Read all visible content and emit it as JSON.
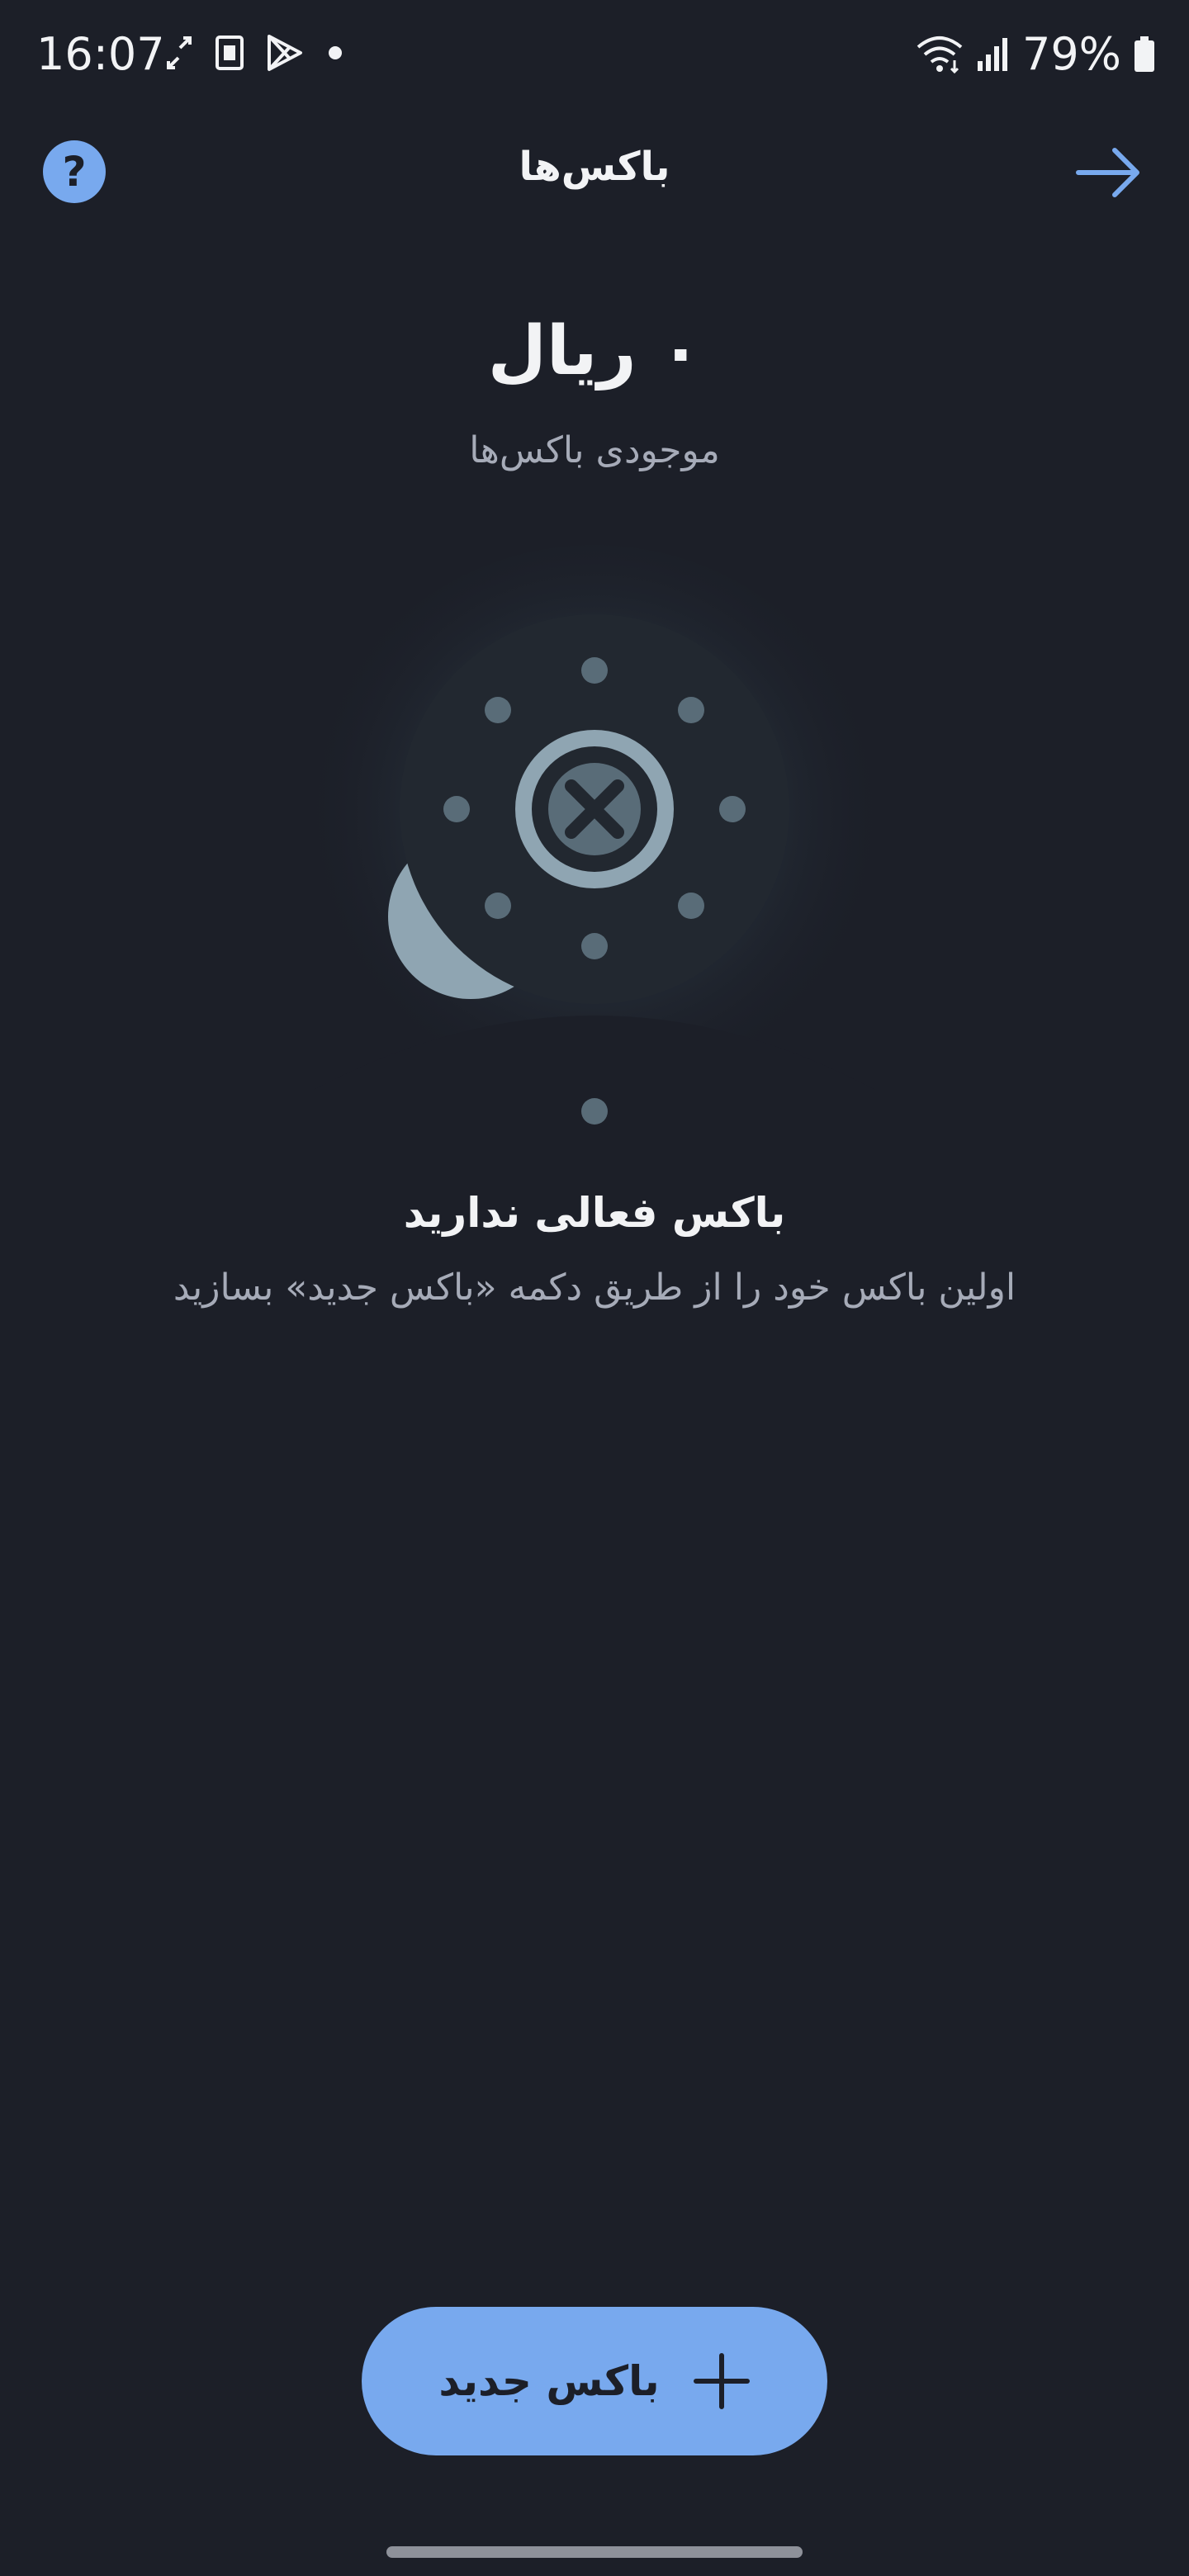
{
  "status_bar": {
    "time": "16:07",
    "battery_percent": "79%",
    "icons": [
      "sync-icon",
      "sim-card-icon",
      "play-store-icon",
      "notification-dot-icon",
      "wifi-icon",
      "signal-icon",
      "battery-icon"
    ]
  },
  "header": {
    "title": "باکس‌ها",
    "help_icon": "help-icon",
    "help_glyph": "?",
    "back_icon": "arrow-right-icon"
  },
  "balance": {
    "amount": "۰ ریال",
    "label": "موجودی باکس‌ها"
  },
  "empty_state": {
    "illustration": "empty-box-illustration",
    "title": "باکس فعالی ندارید",
    "description": "اولین باکس خود را از طریق دکمه «باکس جدید» بسازید"
  },
  "actions": {
    "new_box_label": "باکس جدید",
    "new_box_icon": "plus-icon"
  },
  "colors": {
    "background": "#1c1f28",
    "accent": "#78a9ee",
    "text_primary": "#f2f3f5",
    "text_secondary": "#a6abb8"
  }
}
